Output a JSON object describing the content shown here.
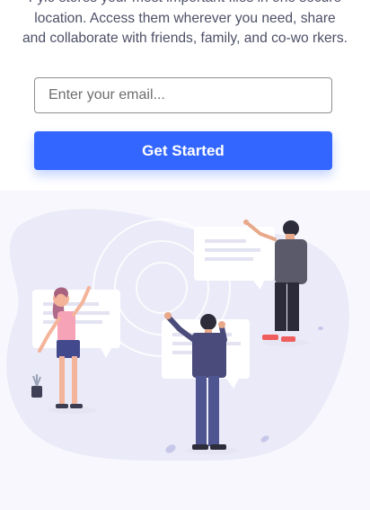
{
  "hero": {
    "line1": "Fylo stores your most important files in one secure",
    "line2": "location. Access them wherever you need, share",
    "line3": "and collaborate with friends, family, and co-wo rkers."
  },
  "signup": {
    "email_placeholder": "Enter your email...",
    "cta_label": "Get Started"
  },
  "colors": {
    "accent": "#3366ff",
    "text": "#4d5066",
    "section_bg": "#f7f7fd"
  }
}
